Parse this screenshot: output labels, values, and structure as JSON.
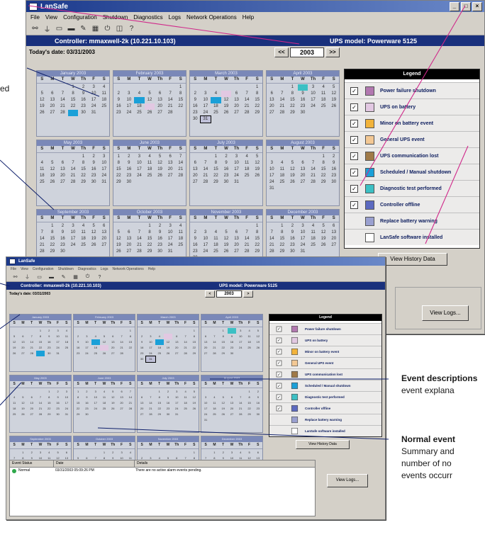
{
  "window_a": {
    "title": "LanSafe",
    "menu": [
      "File",
      "View",
      "Configuration",
      "Shutdown",
      "Diagnostics",
      "Logs",
      "Network Operations",
      "Help"
    ],
    "controller_label": "Controller:  mmaxwell-2k (10.221.10.103)",
    "ups_label": "UPS model:  Powerware 5125",
    "todays_date": "Today's date: 03/31/2003",
    "year": "2003",
    "prev": "<<",
    "next": ">>",
    "months": [
      "January 2003",
      "February 2003",
      "March 2003",
      "April 2003",
      "May 2003",
      "June 2003",
      "July 2003",
      "August 2003",
      "September 2003",
      "October 2003",
      "November 2003",
      "December 2003"
    ],
    "dow": [
      "S",
      "M",
      "T",
      "W",
      "Th",
      "F",
      "S"
    ],
    "legend_title": "Legend",
    "legend": [
      {
        "label": "Power failure shutdown",
        "color": "#b278b0",
        "checked": true
      },
      {
        "label": "UPS on battery",
        "color": "#e2c8e2",
        "checked": true
      },
      {
        "label": "Minor on battery event",
        "color": "#f2b33a",
        "checked": true
      },
      {
        "label": "General UPS event",
        "color": "#f3c894",
        "checked": true
      },
      {
        "label": "UPS communication lost",
        "color": "#a07a48",
        "checked": true
      },
      {
        "label": "Scheduled / Manual shutdown",
        "color": "#1aa0d8",
        "checked": true
      },
      {
        "label": "Diagnostic test performed",
        "color": "#3cc0c4",
        "checked": true
      },
      {
        "label": "Controller offline",
        "color": "#5c6ac0",
        "checked": true
      },
      {
        "label": "Replace battery warning",
        "color": "#9aa0d0",
        "checked": false
      },
      {
        "label": "LanSafe software installed",
        "color": "#ffffff",
        "checked": false
      }
    ],
    "view_history": "View History Data",
    "view_logs": "View Logs..."
  },
  "window_b": {
    "title": "LanSafe",
    "menu": [
      "File",
      "View",
      "Configuration",
      "Shutdown",
      "Diagnostics",
      "Logs",
      "Network Operations",
      "Help"
    ],
    "controller_label": "Controller:  mmaxwell-2k (10.221.10.103)",
    "ups_label": "UPS model:  Powerware 5125",
    "todays_date": "Today's date: 03/31/2003",
    "year": "2003",
    "legend_title": "Legend",
    "view_history": "View History Data",
    "log_headers": [
      "Event Status",
      "Date",
      "Details"
    ],
    "log_row": [
      "Normal",
      "03/31/2003 05:09:26 PM",
      "There are no active alarm events pending."
    ],
    "view_logs": "View Logs..."
  },
  "annotations": {
    "event_desc_title": "Event descriptions",
    "event_desc_body": "event explana",
    "normal_title": "Normal event",
    "normal_l1": "Summary and",
    "normal_l2": "number of no",
    "normal_l3": "events occurr",
    "left_partial": "ed"
  },
  "colors": {
    "titlebar": "#1c3a8c",
    "controller_bar": "#19307c",
    "callout_line": "#d0288a"
  }
}
